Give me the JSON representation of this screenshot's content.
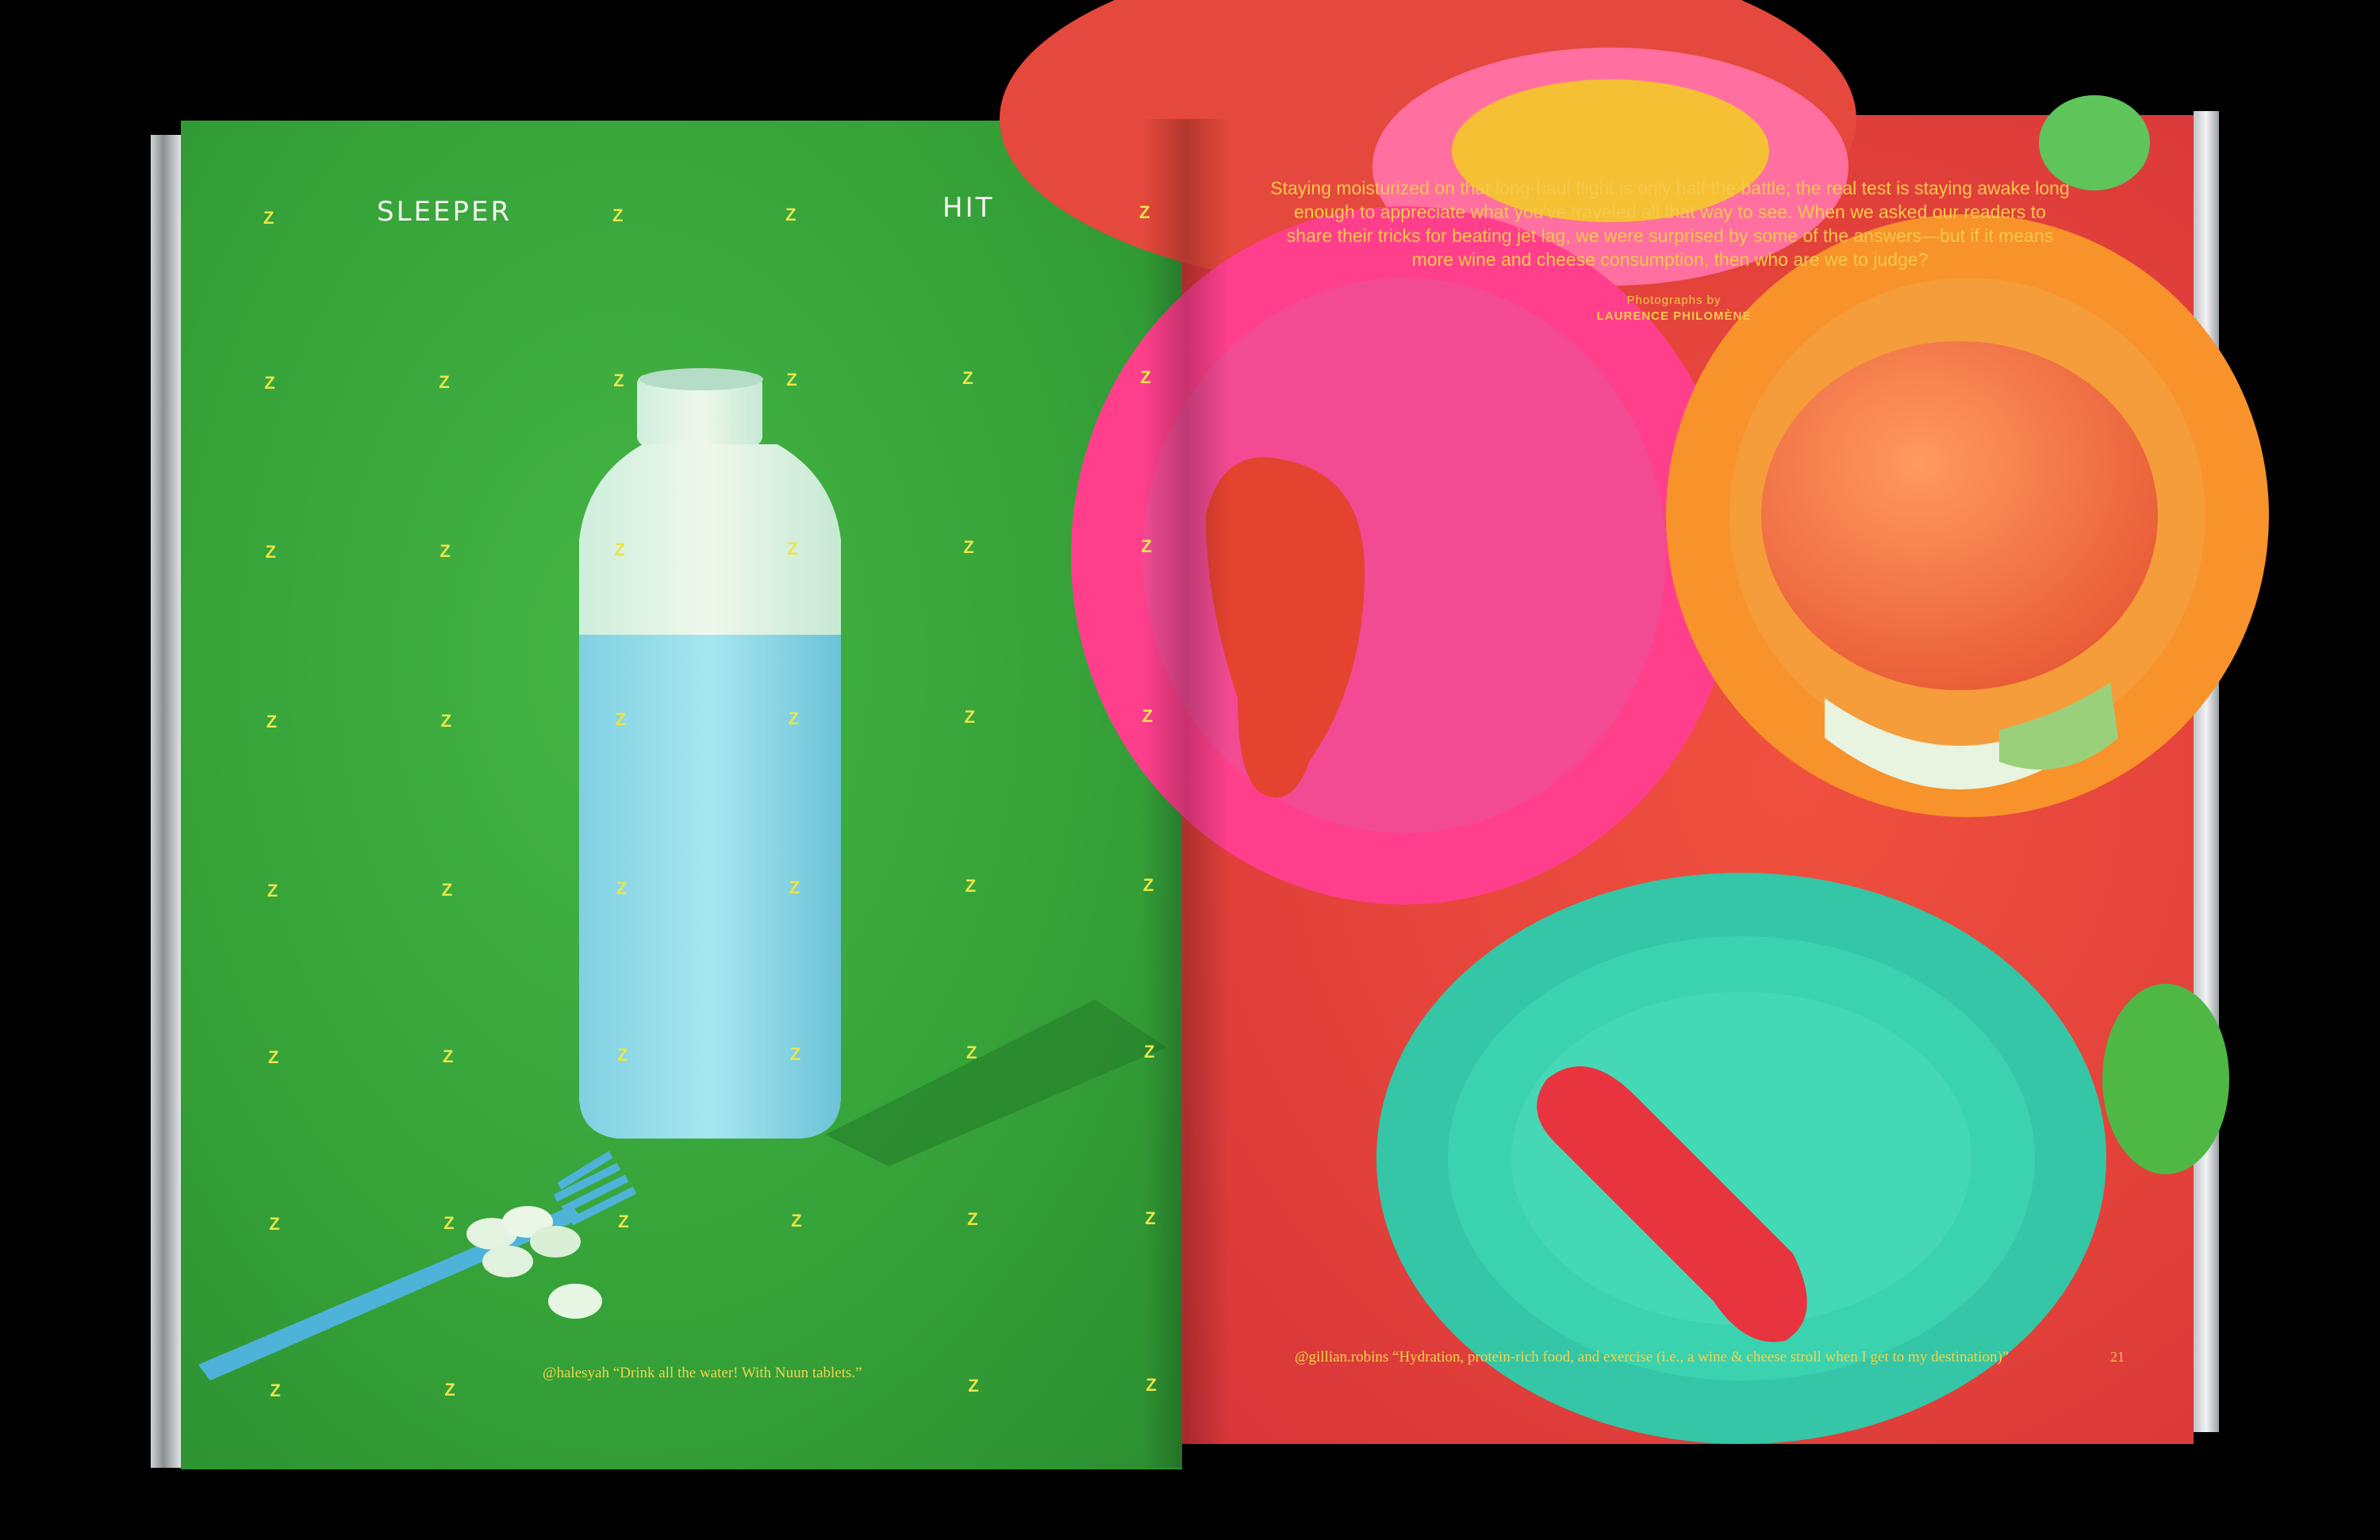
{
  "spread": {
    "headline_left": "SLEEPER",
    "headline_right": "HIT",
    "z_letter": "Z",
    "intro": "Staying moisturized on that long-haul flight is only half the battle; the real test is staying awake long enough to appreciate what you've traveled all that way to see. When we asked our readers to share their tricks for beating jet lag, we were surprised by some of the answers—but if it means more wine and cheese consumption, then who are we to judge?",
    "credit_label": "Photographs by",
    "credit_name": "LAURENCE PHILOMÈNE",
    "caption_left_handle": "@halesyah",
    "caption_left_quote": "“Drink all the water! With Nuun tablets.”",
    "caption_right_handle": "@gillian.robins",
    "caption_right_quote": "“Hydration, protein-rich food, and exercise (i.e., a wine & cheese stroll when I get to my destination)”",
    "page_number": "21"
  },
  "colors": {
    "left_page": "#3aa83c",
    "right_page": "#e8473c",
    "z_color": "#e9e64a",
    "caption_color": "#f1d44a"
  }
}
